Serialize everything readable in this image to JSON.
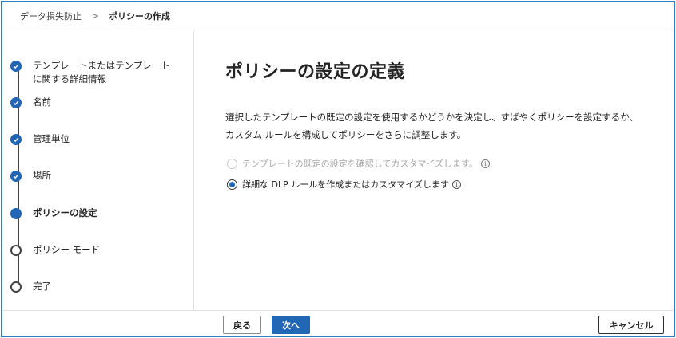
{
  "breadcrumb": {
    "parent": "データ損失防止",
    "separator": ">",
    "current": "ポリシーの作成"
  },
  "steps": [
    {
      "label_line1": "テンプレートまたはテンプレート",
      "label_line2": "に関する詳細情報",
      "state": "done"
    },
    {
      "label": "名前",
      "state": "done"
    },
    {
      "label": "管理単位",
      "state": "done"
    },
    {
      "label": "場所",
      "state": "done"
    },
    {
      "label": "ポリシーの設定",
      "state": "current"
    },
    {
      "label": "ポリシー モード",
      "state": "todo"
    },
    {
      "label": "完了",
      "state": "todo"
    }
  ],
  "main": {
    "title": "ポリシーの設定の定義",
    "description_line1": "選択したテンプレートの既定の設定を使用するかどうかを決定し、すばやくポリシーを設定するか、",
    "description_line2": "カスタム ルールを構成してポリシーをさらに調整します。",
    "options": [
      {
        "label": "テンプレートの既定の設定を確認してカスタマイズします。",
        "checked": false,
        "disabled": true
      },
      {
        "label": "詳細な DLP ルールを作成またはカスタマイズします",
        "checked": true,
        "disabled": false
      }
    ],
    "info_glyph": "i"
  },
  "footer": {
    "back_label": "戻る",
    "next_label": "次へ",
    "cancel_label": "キャンセル"
  },
  "colors": {
    "accent": "#2266b6",
    "frame_border": "#2f7fc1"
  }
}
